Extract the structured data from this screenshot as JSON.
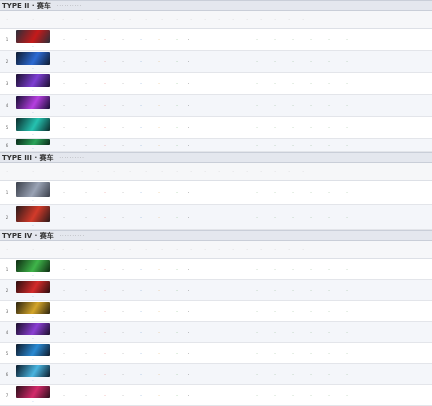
{
  "sections": [
    {
      "title": "TYPE II · 赛车",
      "subtitle": "· · · · · · · · · ·",
      "header_cells": [
        "·",
        "·",
        "·",
        "·",
        "·",
        "·",
        "·",
        "·",
        "·",
        "·",
        "·",
        "·",
        "·",
        "·",
        "·",
        "·",
        "·",
        "·",
        "·"
      ],
      "rows": [
        {
          "idx": "1",
          "label": "·",
          "date": "·",
          "c1": "·",
          "c2": "·",
          "c3": "·",
          "c4": "·",
          "c5": "·",
          "c6": "·",
          "desc": "·",
          "t1": "·",
          "t2": "·",
          "t3": "·",
          "t4": "·",
          "t5": "·",
          "t6": "·",
          "colors": [
            "#2a2f3a",
            "#c51a1a"
          ]
        },
        {
          "idx": "2",
          "label": "·",
          "date": "·",
          "c1": "·",
          "c2": "·",
          "c3": "·",
          "c4": "·",
          "c5": "·",
          "c6": "·",
          "desc": "·",
          "t1": "·",
          "t2": "·",
          "t3": "·",
          "t4": "·",
          "t5": "·",
          "t6": "·",
          "colors": [
            "#0e1a2f",
            "#2b6ad3"
          ]
        },
        {
          "idx": "3",
          "label": "·",
          "date": "·",
          "c1": "·",
          "c2": "·",
          "c3": "·",
          "c4": "·",
          "c5": "·",
          "c6": "·",
          "desc": "·",
          "t1": "·",
          "t2": "·",
          "t3": "·",
          "t4": "·",
          "t5": "·",
          "t6": "·",
          "colors": [
            "#1a0f2e",
            "#7e3fd3"
          ]
        },
        {
          "idx": "4",
          "label": "·",
          "date": "·",
          "c1": "·",
          "c2": "·",
          "c3": "·",
          "c4": "·",
          "c5": "·",
          "c6": "·",
          "desc": "·",
          "t1": "·",
          "t2": "·",
          "t3": "·",
          "t4": "·",
          "t5": "·",
          "t6": "·",
          "colors": [
            "#160d33",
            "#b53fe0"
          ]
        },
        {
          "idx": "5",
          "label": "·",
          "date": "·",
          "c1": "·",
          "c2": "·",
          "c3": "·",
          "c4": "·",
          "c5": "·",
          "c6": "·",
          "desc": "·",
          "t1": "·",
          "t2": "·",
          "t3": "·",
          "t4": "·",
          "t5": "·",
          "t6": "·",
          "colors": [
            "#0b2a2a",
            "#25c2b0"
          ]
        },
        {
          "idx": "6",
          "label": "·",
          "date": "·",
          "c1": "·",
          "c2": "·",
          "c3": "·",
          "c4": "·",
          "c5": "·",
          "c6": "·",
          "desc": "·",
          "t1": "·",
          "t2": "·",
          "t3": "·",
          "t4": "·",
          "t5": "·",
          "t6": "·",
          "colors": [
            "#0a2a1a",
            "#2aa45a"
          ]
        }
      ]
    },
    {
      "title": "TYPE III · 赛车",
      "subtitle": "· · · · · · · · · ·",
      "header_cells": [
        "·",
        "·",
        "·",
        "·",
        "·",
        "·",
        "·",
        "·",
        "·",
        "·",
        "·",
        "·",
        "·",
        "·",
        "·",
        "·",
        "·",
        "·",
        "·"
      ],
      "rows": [
        {
          "idx": "1",
          "label": "·",
          "date": "·",
          "c1": "·",
          "c2": "·",
          "c3": "·",
          "c4": "·",
          "c5": "·",
          "c6": "·",
          "desc": "·",
          "t1": "·",
          "t2": "·",
          "t3": "·",
          "t4": "·",
          "t5": "·",
          "t6": "·",
          "colors": [
            "#3a3f4a",
            "#9aa3b5"
          ]
        },
        {
          "idx": "2",
          "label": "·",
          "date": "·",
          "c1": "·",
          "c2": "·",
          "c3": "·",
          "c4": "·",
          "c5": "·",
          "c6": "·",
          "desc": "·",
          "t1": "·",
          "t2": "·",
          "t3": "·",
          "t4": "·",
          "t5": "·",
          "t6": "·",
          "colors": [
            "#2a1a1a",
            "#d33a2a"
          ]
        }
      ]
    },
    {
      "title": "TYPE IV · 赛车",
      "subtitle": "· · · · · · · · · ·",
      "header_cells": [
        "·",
        "·",
        "·",
        "·",
        "·",
        "·",
        "·",
        "·",
        "·",
        "·",
        "·",
        "·",
        "·",
        "·",
        "·",
        "·",
        "·",
        "·",
        "·"
      ],
      "rows": [
        {
          "idx": "1",
          "label": "·",
          "date": "·",
          "c1": "·",
          "c2": "·",
          "c3": "·",
          "c4": "·",
          "c5": "·",
          "c6": "·",
          "desc": "·",
          "t1": "·",
          "t2": "·",
          "t3": "·",
          "t4": "·",
          "t5": "·",
          "t6": "·",
          "colors": [
            "#0e2a12",
            "#3fb54a"
          ]
        },
        {
          "idx": "2",
          "label": "·",
          "date": "·",
          "c1": "·",
          "c2": "·",
          "c3": "·",
          "c4": "·",
          "c5": "·",
          "c6": "·",
          "desc": "·",
          "t1": "·",
          "t2": "·",
          "t3": "·",
          "t4": "·",
          "t5": "·",
          "t6": "·",
          "colors": [
            "#2a0e0e",
            "#d32a2a"
          ]
        },
        {
          "idx": "3",
          "label": "·",
          "date": "·",
          "c1": "·",
          "c2": "·",
          "c3": "·",
          "c4": "·",
          "c5": "·",
          "c6": "·",
          "desc": "·",
          "t1": "·",
          "t2": "·",
          "t3": "·",
          "t4": "·",
          "t5": "·",
          "t6": "·",
          "colors": [
            "#2a220e",
            "#d3a52a"
          ]
        },
        {
          "idx": "4",
          "label": "·",
          "date": "·",
          "c1": "·",
          "c2": "·",
          "c3": "·",
          "c4": "·",
          "c5": "·",
          "c6": "·",
          "desc": "·",
          "t1": "·",
          "t2": "·",
          "t3": "·",
          "t4": "·",
          "t5": "·",
          "t6": "·",
          "colors": [
            "#1a0e2a",
            "#8a3fd3"
          ]
        },
        {
          "idx": "5",
          "label": "·",
          "date": "·",
          "c1": "·",
          "c2": "·",
          "c3": "·",
          "c4": "·",
          "c5": "·",
          "c6": "·",
          "desc": "·",
          "t1": "·",
          "t2": "·",
          "t3": "·",
          "t4": "·",
          "t5": "·",
          "t6": "·",
          "colors": [
            "#0e1a2a",
            "#2a8ad3"
          ]
        },
        {
          "idx": "6",
          "label": "·",
          "date": "·",
          "c1": "·",
          "c2": "·",
          "c3": "·",
          "c4": "·",
          "c5": "·",
          "c6": "·",
          "desc": "·",
          "t1": "·",
          "t2": "·",
          "t3": "·",
          "t4": "·",
          "t5": "·",
          "t6": "·",
          "colors": [
            "#0a1a2a",
            "#4ab5e0"
          ]
        },
        {
          "idx": "7",
          "label": "·",
          "date": "·",
          "c1": "·",
          "c2": "·",
          "c3": "·",
          "c4": "·",
          "c5": "·",
          "c6": "·",
          "desc": "·",
          "t1": "·",
          "t2": "·",
          "t3": "·",
          "t4": "·",
          "t5": "·",
          "t6": "·",
          "colors": [
            "#2a0e1a",
            "#d32a6a"
          ]
        }
      ]
    }
  ]
}
